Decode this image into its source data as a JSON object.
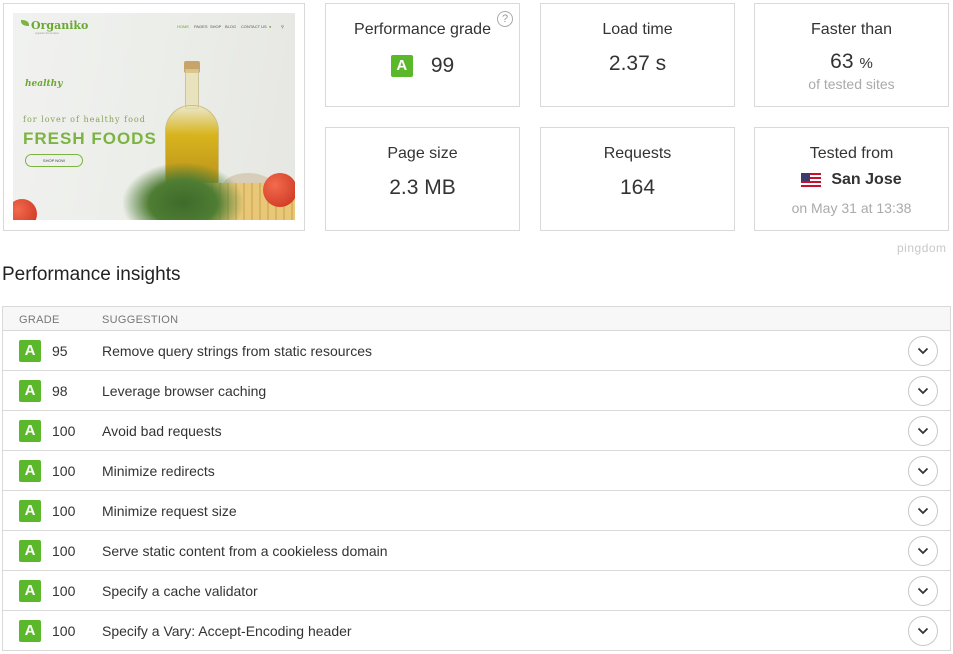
{
  "thumbnail": {
    "logo": "Organiko",
    "logo_sub": "organic food store",
    "nav": [
      "HOME",
      "PAGES",
      "SHOP",
      "BLOG",
      "CONTACT US"
    ],
    "badge": "healthy",
    "tagline": "for lover of healthy food",
    "hero_title": "FRESH FOODS",
    "button": "SHOP NOW"
  },
  "stats": {
    "performance_grade": {
      "label": "Performance grade",
      "grade": "A",
      "value": "99",
      "help": "?"
    },
    "load_time": {
      "label": "Load time",
      "value": "2.37 s"
    },
    "faster_than": {
      "label": "Faster than",
      "value": "63",
      "unit": "%",
      "sub": "of tested sites"
    },
    "page_size": {
      "label": "Page size",
      "value": "2.3 MB"
    },
    "requests": {
      "label": "Requests",
      "value": "164"
    },
    "tested_from": {
      "label": "Tested from",
      "location": "San Jose",
      "date": "on May 31 at 13:38"
    }
  },
  "branding": "pingdom",
  "insights": {
    "title": "Performance insights",
    "col_grade": "GRADE",
    "col_suggestion": "SUGGESTION",
    "rows": [
      {
        "grade": "A",
        "score": "95",
        "suggestion": "Remove query strings from static resources"
      },
      {
        "grade": "A",
        "score": "98",
        "suggestion": "Leverage browser caching"
      },
      {
        "grade": "A",
        "score": "100",
        "suggestion": "Avoid bad requests"
      },
      {
        "grade": "A",
        "score": "100",
        "suggestion": "Minimize redirects"
      },
      {
        "grade": "A",
        "score": "100",
        "suggestion": "Minimize request size"
      },
      {
        "grade": "A",
        "score": "100",
        "suggestion": "Serve static content from a cookieless domain"
      },
      {
        "grade": "A",
        "score": "100",
        "suggestion": "Specify a cache validator"
      },
      {
        "grade": "A",
        "score": "100",
        "suggestion": "Specify a Vary: Accept-Encoding header"
      }
    ]
  },
  "colors": {
    "grade_green": "#5cb82b",
    "border": "#d9d9d9",
    "muted": "#aaaaaa"
  },
  "icons": {
    "help": "help-circle-icon",
    "expand": "chevron-down-icon",
    "flag": "us-flag-icon"
  }
}
